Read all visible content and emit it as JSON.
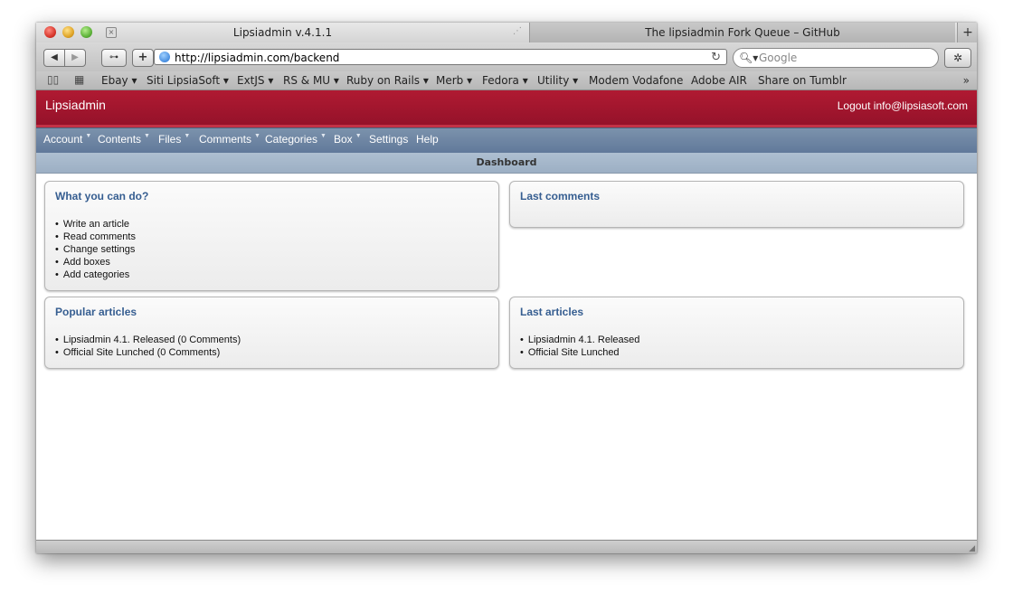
{
  "browser": {
    "active_tab": "Lipsiadmin v.4.1.1",
    "inactive_tab": "The lipsiadmin Fork Queue – GitHub",
    "new_tab_label": "+",
    "url": "http://lipsiadmin.com/backend",
    "search_placeholder": "Google",
    "bookmarks": [
      {
        "label": "Ebay ▾"
      },
      {
        "label": "Siti LipsiaSoft ▾"
      },
      {
        "label": "ExtJS ▾"
      },
      {
        "label": "RS & MU ▾"
      },
      {
        "label": "Ruby on Rails ▾"
      },
      {
        "label": "Merb ▾"
      },
      {
        "label": "Fedora ▾"
      },
      {
        "label": "Utility ▾"
      },
      {
        "label": "Modem Vodafone"
      },
      {
        "label": "Adobe AIR"
      },
      {
        "label": "Share on Tumblr"
      }
    ],
    "more_bookmarks": "»"
  },
  "app": {
    "title": "Lipsiadmin",
    "logout": "Logout info@lipsiasoft.com",
    "nav": [
      {
        "label": "Account",
        "dropdown": true
      },
      {
        "label": "Contents",
        "dropdown": true
      },
      {
        "label": "Files",
        "dropdown": true
      },
      {
        "label": "Comments",
        "dropdown": true
      },
      {
        "label": "Categories",
        "dropdown": true
      },
      {
        "label": "Box",
        "dropdown": true
      },
      {
        "label": "Settings",
        "dropdown": false
      },
      {
        "label": "Help",
        "dropdown": false
      }
    ],
    "dashboard_label": "Dashboard"
  },
  "panels": {
    "what_you_can_do": {
      "title": "What you can do?",
      "items": [
        "Write an article",
        "Read comments",
        "Change settings",
        "Add boxes",
        "Add categories"
      ]
    },
    "last_comments": {
      "title": "Last comments",
      "items": []
    },
    "popular_articles": {
      "title": "Popular articles",
      "items": [
        "Lipsiadmin 4.1. Released (0 Comments)",
        "Official Site Lunched (0 Comments)"
      ]
    },
    "last_articles": {
      "title": "Last articles",
      "items": [
        "Lipsiadmin 4.1. Released",
        "Official Site Lunched"
      ]
    }
  },
  "icons": {
    "close": "red-traffic-light",
    "minimize": "yellow-traffic-light",
    "maximize": "green-traffic-light",
    "reload": "↻",
    "search": "magnifier-icon",
    "bug": "bug-icon"
  },
  "colors": {
    "header": "#a4172e",
    "nav": "#6e86a2",
    "panel_title": "#365e91"
  }
}
